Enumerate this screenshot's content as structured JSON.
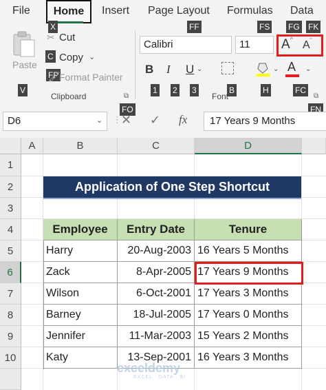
{
  "tabs": [
    "File",
    "Home",
    "Insert",
    "Page Layout",
    "Formulas",
    "Data"
  ],
  "active_tab": "Home",
  "keytips": {
    "cut": "X",
    "copy": "C",
    "format_painter": "FP",
    "paste": "V",
    "font_name": "FF",
    "font_size": "FS",
    "grow": "FG",
    "shrink": "FK",
    "bold": "1",
    "italic": "2",
    "underline": "3",
    "border": "B",
    "fill": "H",
    "font_color": "FC",
    "clipboard_launcher": "FO",
    "font_launcher": "FN"
  },
  "clipboard": {
    "paste": "Paste",
    "cut": "Cut",
    "copy": "Copy",
    "format_painter": "Format Painter",
    "group": "Clipboard"
  },
  "font": {
    "name": "Calibri",
    "size": "11",
    "group": "Font",
    "grow_glyph": "A",
    "shrink_glyph": "A",
    "bold": "B",
    "italic": "I",
    "underline": "U",
    "font_color_glyph": "A"
  },
  "formula_bar": {
    "name_box": "D6",
    "fx": "fx",
    "value": "17 Years 9 Months"
  },
  "columns": [
    "A",
    "B",
    "C",
    "D"
  ],
  "rows": [
    "1",
    "2",
    "3",
    "4",
    "5",
    "6",
    "7",
    "8",
    "9",
    "10"
  ],
  "sheet": {
    "title": "Application of One Step Shortcut",
    "headers": [
      "Employee",
      "Entry Date",
      "Tenure"
    ],
    "data": [
      [
        "Harry",
        "20-Aug-2003",
        "16 Years 5 Months"
      ],
      [
        "Zack",
        "8-Apr-2005",
        "17 Years 9 Months"
      ],
      [
        "Wilson",
        "6-Oct-2001",
        "17 Years 3 Months"
      ],
      [
        "Barney",
        "18-Jul-2005",
        "17 Years 0 Months"
      ],
      [
        "Jennifer",
        "11-Mar-2003",
        "15 Years 2 Months"
      ],
      [
        "Katy",
        "13-Sep-2001",
        "16 Years 3 Months"
      ]
    ]
  },
  "watermark": {
    "name": "exceldemy",
    "tagline": "EXCEL · DATA · BI"
  },
  "colors": {
    "excel_green": "#217346",
    "title_fill": "#203864",
    "header_fill": "#c6e0b4",
    "highlight": "#e21d1d",
    "keytip": "#444444"
  }
}
